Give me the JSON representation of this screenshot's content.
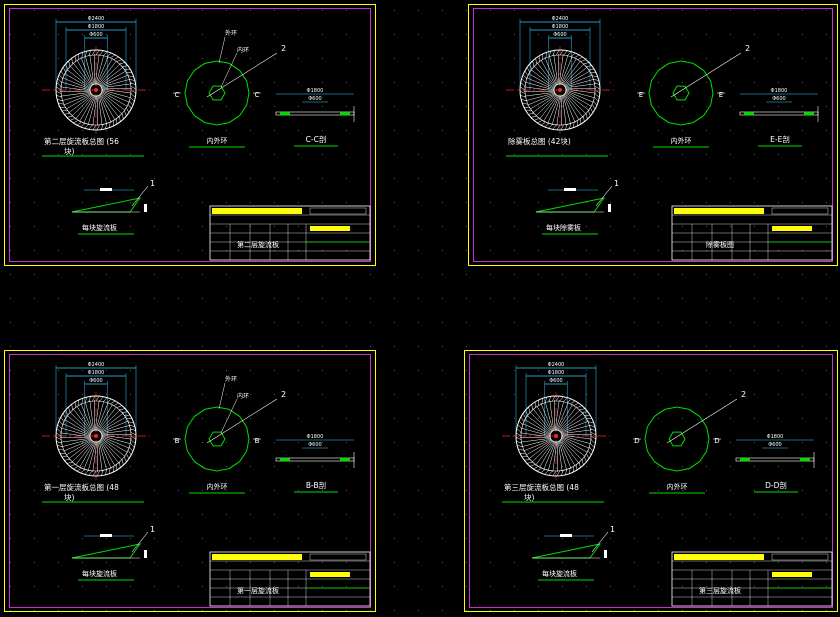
{
  "colors": {
    "background": "#000000",
    "sheet_border": "#ffff00",
    "frame_border": "#c832c8",
    "geometry": "#ffffff",
    "outline": "#00dd00",
    "dimension": "#33ccff",
    "centerline": "#ff2020",
    "annotation": "#ffffff",
    "titleblock_fill": "#ffff00",
    "grid_dots": "#5a5a5a"
  },
  "sheets": [
    {
      "main_view_title": "第二层旋流板总图 (56",
      "main_view_title_line2": "块)",
      "dims": [
        "Φ2400",
        "Φ1800",
        "Φ600"
      ],
      "ring_labels": [
        "外环",
        "内环"
      ],
      "ring_view_title": "内外环",
      "section_letter": "C",
      "section_title": "C-C剖",
      "section_dims": [
        "Φ1800",
        "Φ600"
      ],
      "callouts": [
        "1",
        "2"
      ],
      "blade_title": "每块旋流板",
      "titleblock_name": "第二层旋流板"
    },
    {
      "main_view_title": "除雾板总图 (42块)",
      "main_view_title_line2": "",
      "dims": [
        "Φ2400",
        "Φ1800",
        "Φ600"
      ],
      "ring_labels": [],
      "ring_view_title": "内外环",
      "section_letter": "E",
      "section_title": "E-E剖",
      "section_dims": [
        "Φ1800",
        "Φ600"
      ],
      "callouts": [
        "1",
        "2"
      ],
      "blade_title": "每块除雾板",
      "titleblock_name": "除雾板图"
    },
    {
      "main_view_title": "第一层旋流板总图 (48",
      "main_view_title_line2": "块)",
      "dims": [
        "Φ2400",
        "Φ1800",
        "Φ600"
      ],
      "ring_labels": [
        "外环",
        "内环"
      ],
      "ring_view_title": "内外环",
      "section_letter": "B",
      "section_title": "B-B剖",
      "section_dims": [
        "Φ1800",
        "Φ600"
      ],
      "callouts": [
        "1",
        "2"
      ],
      "blade_title": "每块旋流板",
      "titleblock_name": "第一层旋流板"
    },
    {
      "main_view_title": "第三层旋流板总图 (48",
      "main_view_title_line2": "块)",
      "dims": [
        "Φ2400",
        "Φ1800",
        "Φ600"
      ],
      "ring_labels": [],
      "ring_view_title": "内外环",
      "section_letter": "D",
      "section_title": "D-D剖",
      "section_dims": [
        "Φ1800",
        "Φ600"
      ],
      "callouts": [
        "1",
        "2"
      ],
      "blade_title": "每块旋流板",
      "titleblock_name": "第三层旋流板"
    }
  ]
}
